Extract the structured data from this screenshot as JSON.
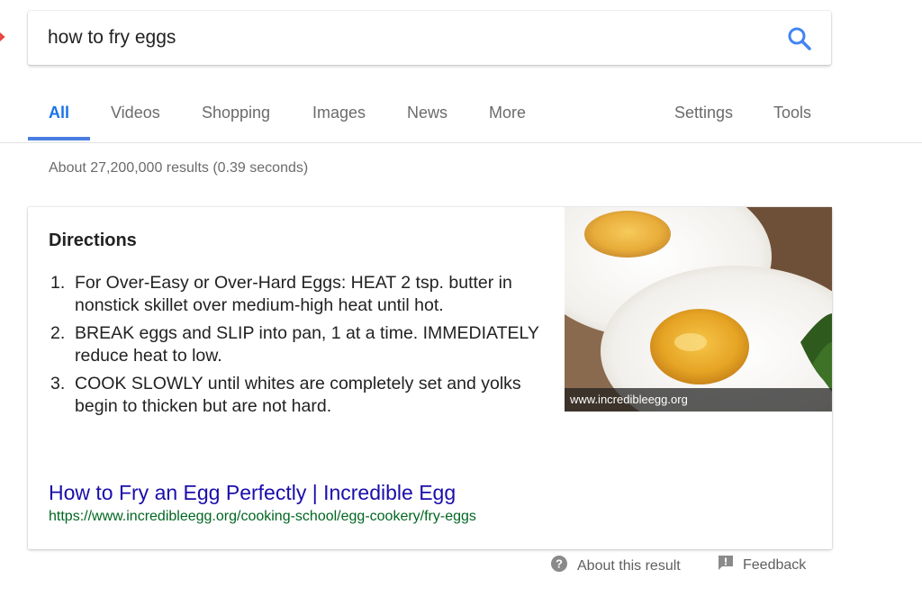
{
  "search": {
    "query": "how to fry eggs",
    "icon": "magnifier-icon"
  },
  "tabs": [
    {
      "label": "All",
      "active": true
    },
    {
      "label": "Videos"
    },
    {
      "label": "Shopping"
    },
    {
      "label": "Images"
    },
    {
      "label": "News"
    },
    {
      "label": "More"
    },
    {
      "label": "Settings"
    },
    {
      "label": "Tools"
    }
  ],
  "results_stats": "About 27,200,000 results (0.39 seconds)",
  "snippet": {
    "heading": "Directions",
    "steps": [
      {
        "num": "1.",
        "text": "For Over-Easy or Over-Hard Eggs: HEAT 2 tsp. butter in nonstick skillet over medium-high heat until hot."
      },
      {
        "num": "2.",
        "text": "BREAK eggs and SLIP into pan, 1 at a time. IMMEDIATELY reduce heat to low."
      },
      {
        "num": "3.",
        "text": "COOK SLOWLY until whites are completely set and yolks begin to thicken but are not hard."
      }
    ],
    "image_caption": "www.incredibleegg.org",
    "result_title": "How to Fry an Egg Perfectly | Incredible Egg",
    "result_url": "https://www.incredibleegg.org/cooking-school/egg-cookery/fry-eggs"
  },
  "footer": {
    "about_label": "About this result",
    "feedback_label": "Feedback"
  },
  "colors": {
    "accent_blue": "#4a7de1",
    "link_blue": "#1a0dab",
    "url_green": "#006621"
  }
}
